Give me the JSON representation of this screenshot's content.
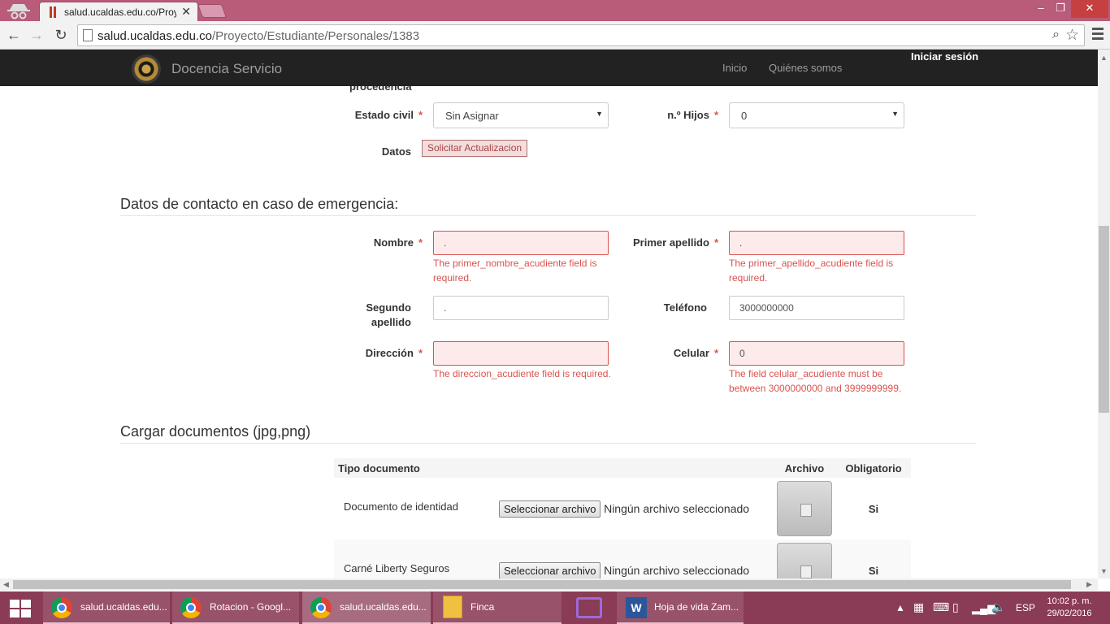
{
  "browser": {
    "tab_title": "salud.ucaldas.edu.co/Proye",
    "url_host": "salud.ucaldas.edu.co",
    "url_path": "/Proyecto/Estudiante/Personales/1383"
  },
  "site": {
    "brand": "Docencia Servicio",
    "nav": [
      "Inicio",
      "Quiénes somos"
    ],
    "login": "Iniciar sesión"
  },
  "form": {
    "cut_label": "procedencia",
    "estado_civil_label": "Estado civil",
    "estado_civil_value": "Sin Asignar",
    "hijos_label": "n.º Hijos",
    "hijos_value": "0",
    "datos_label": "Datos",
    "solicitar_button": "Solicitar Actualizacion",
    "required_mark": "*"
  },
  "emergency": {
    "heading": "Datos de contacto en caso de emergencia:",
    "nombre_label": "Nombre",
    "nombre_value": ".",
    "nombre_error": "The primer_nombre_acudiente field is required.",
    "primer_apellido_label": "Primer apellido",
    "primer_apellido_value": ".",
    "primer_apellido_error": "The primer_apellido_acudiente field is required.",
    "segundo_apellido_label_1": "Segundo",
    "segundo_apellido_label_2": "apellido",
    "segundo_apellido_value": ".",
    "telefono_label": "Teléfono",
    "telefono_value": "3000000000",
    "direccion_label": "Dirección",
    "direccion_value": "",
    "direccion_error": "The direccion_acudiente field is required.",
    "celular_label": "Celular",
    "celular_value": "0",
    "celular_error": "The field celular_acudiente must be between 3000000000 and 3999999999."
  },
  "documents": {
    "heading": "Cargar documentos (jpg,png)",
    "columns": [
      "Tipo documento",
      "Archivo",
      "Obligatorio"
    ],
    "file_button": "Seleccionar archivo",
    "no_file": "Ningún archivo seleccionado",
    "rows": [
      {
        "tipo": "Documento de identidad",
        "obligatorio": "Si"
      },
      {
        "tipo": "Carné Liberty Seguros",
        "obligatorio": "Si"
      }
    ]
  },
  "taskbar": {
    "items": [
      "salud.ucaldas.edu...",
      "Rotacion - Googl...",
      "salud.ucaldas.edu...",
      "Finca",
      "Hoja de vida Zam..."
    ],
    "lang": "ESP",
    "time": "10:02 p. m.",
    "date": "29/02/2016"
  }
}
